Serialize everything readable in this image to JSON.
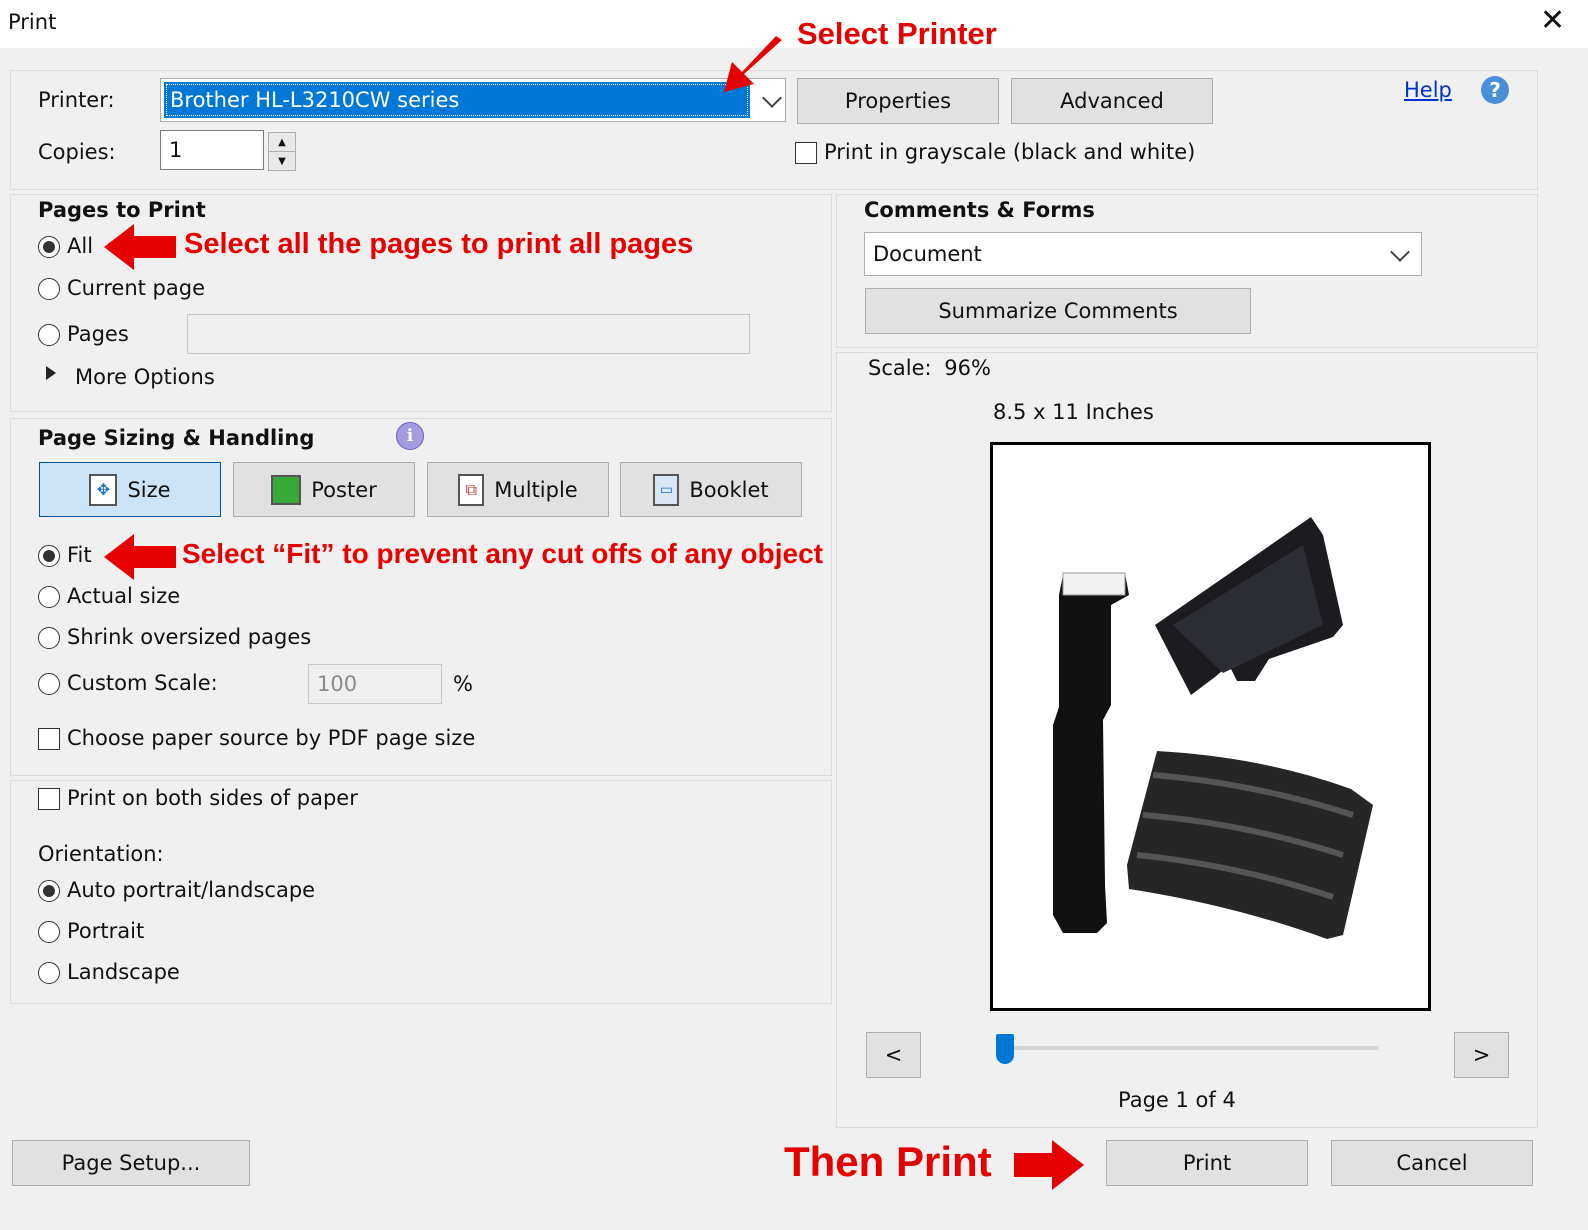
{
  "window": {
    "title": "Print"
  },
  "printer": {
    "label": "Printer:",
    "selected": "Brother HL-L3210CW series",
    "properties_label": "Properties",
    "advanced_label": "Advanced",
    "help_label": "Help"
  },
  "copies": {
    "label": "Copies:",
    "value": "1"
  },
  "grayscale": {
    "label": "Print in grayscale (black and white)",
    "checked": false
  },
  "pages_to_print": {
    "heading": "Pages to Print",
    "options": [
      "All",
      "Current page",
      "Pages"
    ],
    "selected": "All",
    "pages_value": "",
    "more_options": "More Options"
  },
  "page_sizing": {
    "heading": "Page Sizing & Handling",
    "tabs": [
      "Size",
      "Poster",
      "Multiple",
      "Booklet"
    ],
    "active_tab": "Size",
    "options": [
      "Fit",
      "Actual size",
      "Shrink oversized pages",
      "Custom Scale:"
    ],
    "selected": "Fit",
    "custom_scale_value": "100",
    "percent": "%",
    "paper_source_label": "Choose paper source by PDF page size"
  },
  "duplex": {
    "label": "Print on both sides of paper",
    "checked": false
  },
  "orientation": {
    "label": "Orientation:",
    "options": [
      "Auto portrait/landscape",
      "Portrait",
      "Landscape"
    ],
    "selected": "Auto portrait/landscape"
  },
  "comments_forms": {
    "heading": "Comments & Forms",
    "selected": "Document",
    "summarize_label": "Summarize Comments"
  },
  "preview": {
    "scale_label": "Scale:",
    "scale_value": "96%",
    "paper_size": "8.5 x 11 Inches",
    "prev_label": "<",
    "next_label": ">",
    "page_indicator": "Page 1 of 4"
  },
  "footer": {
    "page_setup_label": "Page Setup...",
    "print_label": "Print",
    "cancel_label": "Cancel"
  },
  "annotations": {
    "select_printer": "Select Printer",
    "select_all": "Select all the pages to print all pages",
    "select_fit": "Select “Fit” to prevent any cut offs of any object",
    "then_print": "Then Print"
  },
  "colors": {
    "annotation": "#e60000",
    "selection": "#0078d7",
    "active_tab": "#cce4f7",
    "dialog_bg": "#f0f0f0"
  }
}
